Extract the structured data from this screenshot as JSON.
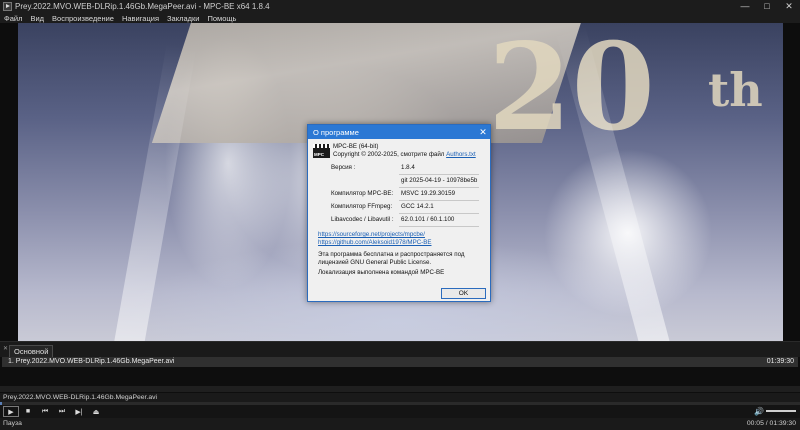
{
  "window": {
    "title": "Prey.2022.MVO.WEB-DLRip.1.46Gb.MegaPeer.avi - MPC-BE x64 1.8.4",
    "controls": [
      "—",
      "□",
      "✕"
    ]
  },
  "menu": [
    "Файл",
    "Вид",
    "Воспроизведение",
    "Навигация",
    "Закладки",
    "Помощь"
  ],
  "dialog": {
    "title": "О программе",
    "close": "✕",
    "product": "MPC-BE (64-bit)",
    "copyright_prefix": "Copyright © 2002-2025, смотрите файл ",
    "copyright_link": "Authors.txt",
    "rows": [
      {
        "key": "Версия :",
        "value": "1.8.4"
      },
      {
        "key": "",
        "value": "git 2025-04-19 - 10978be5b"
      },
      {
        "key": "Компилятор MPC-BE:",
        "value": "MSVC 19.29.30159"
      },
      {
        "key": "Компилятор FFmpeg:",
        "value": "GCC 14.2.1"
      },
      {
        "key": "Libavcodec / Libavutil :",
        "value": "62.0.101 / 60.1.100"
      }
    ],
    "links": [
      "https://sourceforge.net/projects/mpcbe/",
      "https://github.com/Aleksoid1978/MPC-BE"
    ],
    "license_line1": "Эта программа бесплатна и распространяется под",
    "license_line2": "лицензией GNU General Public License.",
    "localization": "Локализация выполнена командой MPC-BE",
    "ok": "OK"
  },
  "playlist": {
    "tab": "Основной",
    "tab_close": "✕",
    "items": [
      {
        "name": "1. Prey.2022.MVO.WEB-DLRip.1.46Gb.MegaPeer.avi",
        "duration": "01:39:30"
      }
    ]
  },
  "file_line": "Prey.2022.MVO.WEB-DLRip.1.46Gb.MegaPeer.avi",
  "player": {
    "progress_fraction": 0.0009,
    "volume_fraction": 1.0,
    "buttons": {
      "play": "▶",
      "stop": "■",
      "prev": "⏮",
      "next": "⏭",
      "frame": "▶|",
      "eject": "⏏"
    },
    "volume_icon": "🔊"
  },
  "status": {
    "state": "Пауза",
    "time": "00:05 / 01:39:30"
  },
  "video_overlay": {
    "digits": "20",
    "suffix": "th"
  }
}
